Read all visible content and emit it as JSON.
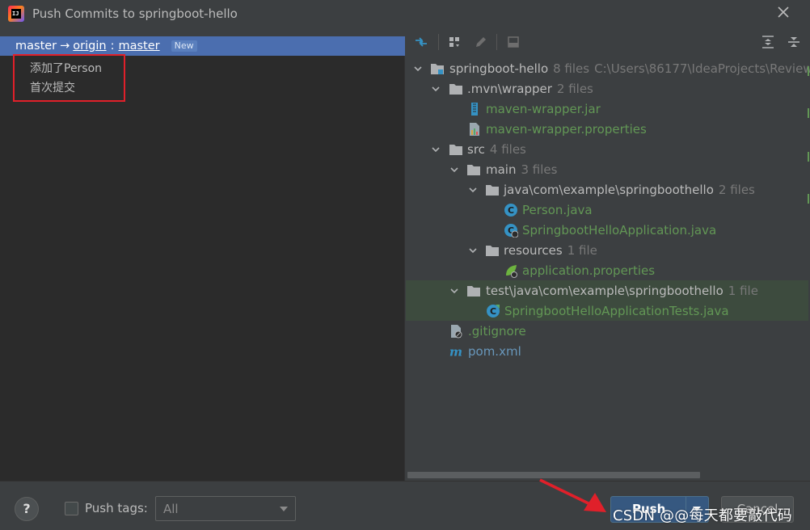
{
  "window": {
    "title": "Push Commits to springboot-hello",
    "logo_text": "IJ"
  },
  "branch": {
    "local": "master",
    "arrow": "→",
    "remote": "origin",
    "separator": ":",
    "remote_branch": "master",
    "badge": "New"
  },
  "commits": [
    {
      "message": "添加了Person"
    },
    {
      "message": "首次提交"
    }
  ],
  "tree": {
    "root": {
      "name": "springboot-hello",
      "count": "8 files",
      "path": "C:\\Users\\86177\\IdeaProjects\\Review"
    },
    "mvn": {
      "name": ".mvn\\wrapper",
      "count": "2 files"
    },
    "mvn_jar": {
      "name": "maven-wrapper.jar"
    },
    "mvn_props": {
      "name": "maven-wrapper.properties"
    },
    "src": {
      "name": "src",
      "count": "4 files"
    },
    "main": {
      "name": "main",
      "count": "3 files"
    },
    "java_pkg": {
      "name": "java\\com\\example\\springboothello",
      "count": "2 files"
    },
    "person": {
      "name": "Person.java"
    },
    "app": {
      "name": "SpringbootHelloApplication.java"
    },
    "resources": {
      "name": "resources",
      "count": "1 file"
    },
    "app_props": {
      "name": "application.properties"
    },
    "test_pkg": {
      "name": "test\\java\\com\\example\\springboothello",
      "count": "1 file"
    },
    "app_tests": {
      "name": "SpringbootHelloApplicationTests.java"
    },
    "gitignore": {
      "name": ".gitignore"
    },
    "pom": {
      "name": "pom.xml"
    }
  },
  "footer": {
    "help": "?",
    "push_tags_label": "Push tags:",
    "tags_select_value": "All",
    "push_label": "Push",
    "cancel_label": "Cancel"
  },
  "watermark": "CSDN @@每天都要敲代码",
  "colors": {
    "selection": "#4b6eaf",
    "added_file": "#629755",
    "highlight_row": "#3d4b3e",
    "annotation_red": "#e0202a",
    "push_button": "#365880"
  }
}
